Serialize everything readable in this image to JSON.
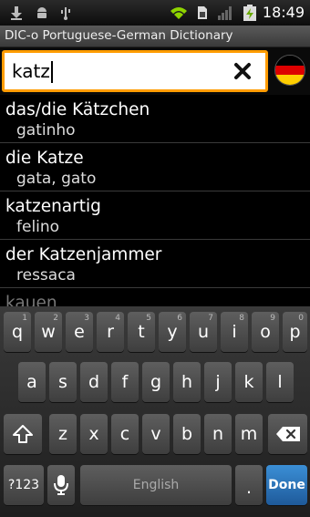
{
  "status_bar": {
    "time": "18:49",
    "icons": [
      "download-icon",
      "android-icon",
      "usb-icon",
      "wifi-icon",
      "sim-icon",
      "signal-icon",
      "battery-charging-icon"
    ]
  },
  "app": {
    "title": "DIC-o Portuguese-German Dictionary"
  },
  "search": {
    "value": "katz",
    "clear_icon": "close-icon",
    "language_flag": "germany-flag-icon",
    "accent_color": "#ff9c00"
  },
  "results": [
    {
      "german": "das/die Kätzchen",
      "portuguese": "gatinho"
    },
    {
      "german": "die Katze",
      "portuguese": "gata, gato"
    },
    {
      "german": "katzenartig",
      "portuguese": "felino"
    },
    {
      "german": "der Katzenjammer",
      "portuguese": "ressaca"
    },
    {
      "german": "kauen",
      "portuguese": ""
    }
  ],
  "keyboard": {
    "row1": [
      {
        "label": "q",
        "hint": "1"
      },
      {
        "label": "w",
        "hint": "2"
      },
      {
        "label": "e",
        "hint": "3"
      },
      {
        "label": "r",
        "hint": "4"
      },
      {
        "label": "t",
        "hint": "5"
      },
      {
        "label": "y",
        "hint": "6"
      },
      {
        "label": "u",
        "hint": "7"
      },
      {
        "label": "i",
        "hint": "8"
      },
      {
        "label": "o",
        "hint": "9"
      },
      {
        "label": "p",
        "hint": "0"
      }
    ],
    "row2": [
      "a",
      "s",
      "d",
      "f",
      "g",
      "h",
      "j",
      "k",
      "l"
    ],
    "row3": [
      "z",
      "x",
      "c",
      "v",
      "b",
      "n",
      "m"
    ],
    "symbols_label": "?123",
    "space_label": "English",
    "period_label": ".",
    "done_label": "Done",
    "shift_icon": "shift-icon",
    "delete_icon": "backspace-icon",
    "mic_icon": "microphone-icon",
    "done_color": "#2f7fc4"
  }
}
